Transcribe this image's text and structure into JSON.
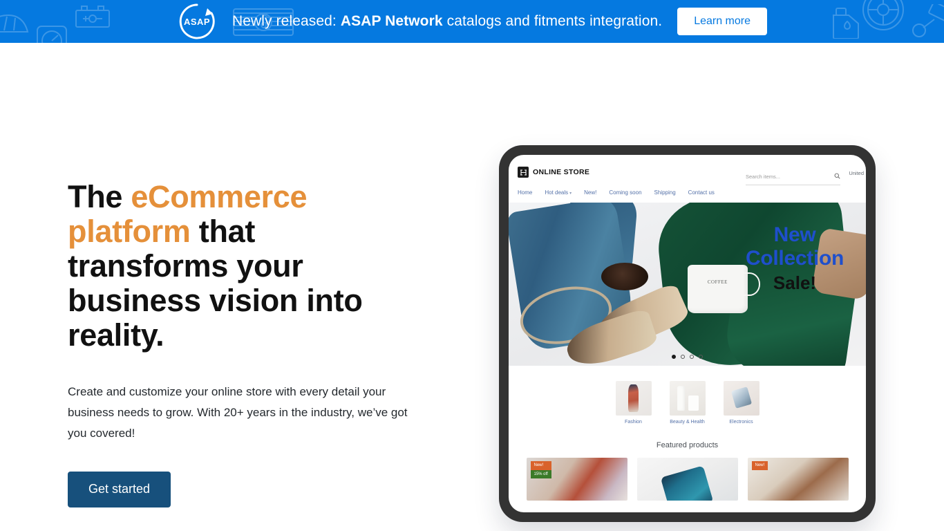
{
  "banner": {
    "logo_alt": "ASAP",
    "message_prefix": "Newly released: ",
    "message_strong": "ASAP Network",
    "message_suffix": " catalogs and fitments integration.",
    "cta_label": "Learn more",
    "bg_color": "#0579E0",
    "decor_icons": [
      "car-icon",
      "battery-icon",
      "gauge-icon",
      "radiator-fan-icon",
      "oil-can-icon",
      "wheel-icon",
      "piston-icon"
    ]
  },
  "hero": {
    "heading_part1": "The ",
    "heading_accent1": "eCommerce platform",
    "heading_part2": " that transforms your business vision into reality.",
    "accent_color": "#E5903A",
    "subtext": "Create and customize your online store with every detail your business needs to grow. With 20+ years in the industry, we’ve got you covered!",
    "cta_label": "Get started",
    "cta_color": "#17507C"
  },
  "mockup": {
    "device": "tablet",
    "store": {
      "brand_name": "ONLINE STORE",
      "search_placeholder": "Search items...",
      "search_value": "",
      "region_label": "United",
      "nav": [
        {
          "label": "Home",
          "has_caret": false
        },
        {
          "label": "Hot deals",
          "has_caret": true
        },
        {
          "label": "New!",
          "has_caret": false
        },
        {
          "label": "Coming soon",
          "has_caret": false
        },
        {
          "label": "Shipping",
          "has_caret": false
        },
        {
          "label": "Contact us",
          "has_caret": false
        }
      ],
      "hero_slide": {
        "line1": "New",
        "line2": "Collection",
        "line3": "Sale!",
        "line1_color": "#1F4FCC",
        "line3_color": "#111111",
        "dots_total": 4,
        "active_dot": 1
      },
      "categories": [
        {
          "label": "Fashion"
        },
        {
          "label": "Beauty & Health"
        },
        {
          "label": "Electronics"
        }
      ],
      "featured_title": "Featured products",
      "products": [
        {
          "badges": [
            "New!",
            "15% off"
          ]
        },
        {
          "badges": []
        },
        {
          "badges": [
            "New!"
          ]
        }
      ]
    }
  }
}
